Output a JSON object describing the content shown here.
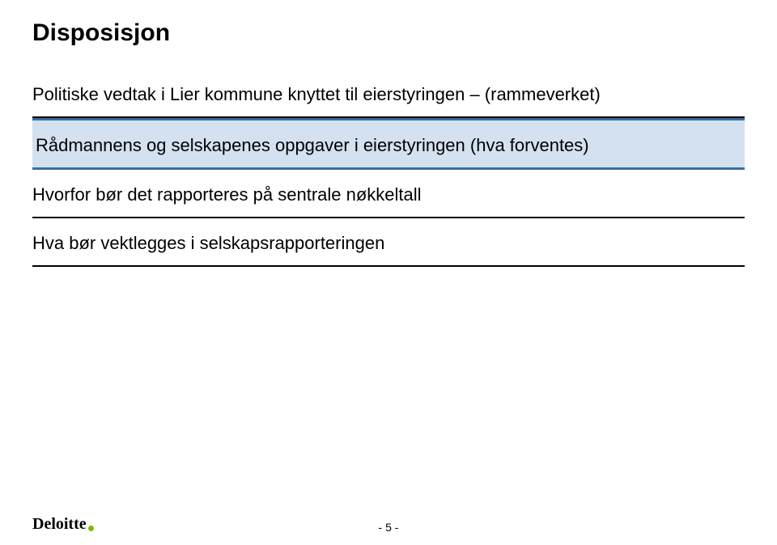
{
  "title": "Disposisjon",
  "items": [
    "Politiske vedtak i Lier kommune knyttet til eierstyringen – (rammeverket)",
    "Rådmannens og selskapenes oppgaver i eierstyringen (hva forventes)",
    "Hvorfor bør det rapporteres på sentrale nøkkeltall",
    "Hva bør vektlegges i selskapsrapporteringen"
  ],
  "footer": {
    "logo_text": "Deloitte",
    "page_number": "- 5 -"
  },
  "colors": {
    "highlight_bg": "#d4e1f0",
    "highlight_border": "#3a6ea5",
    "logo_dot": "#7fba00"
  }
}
